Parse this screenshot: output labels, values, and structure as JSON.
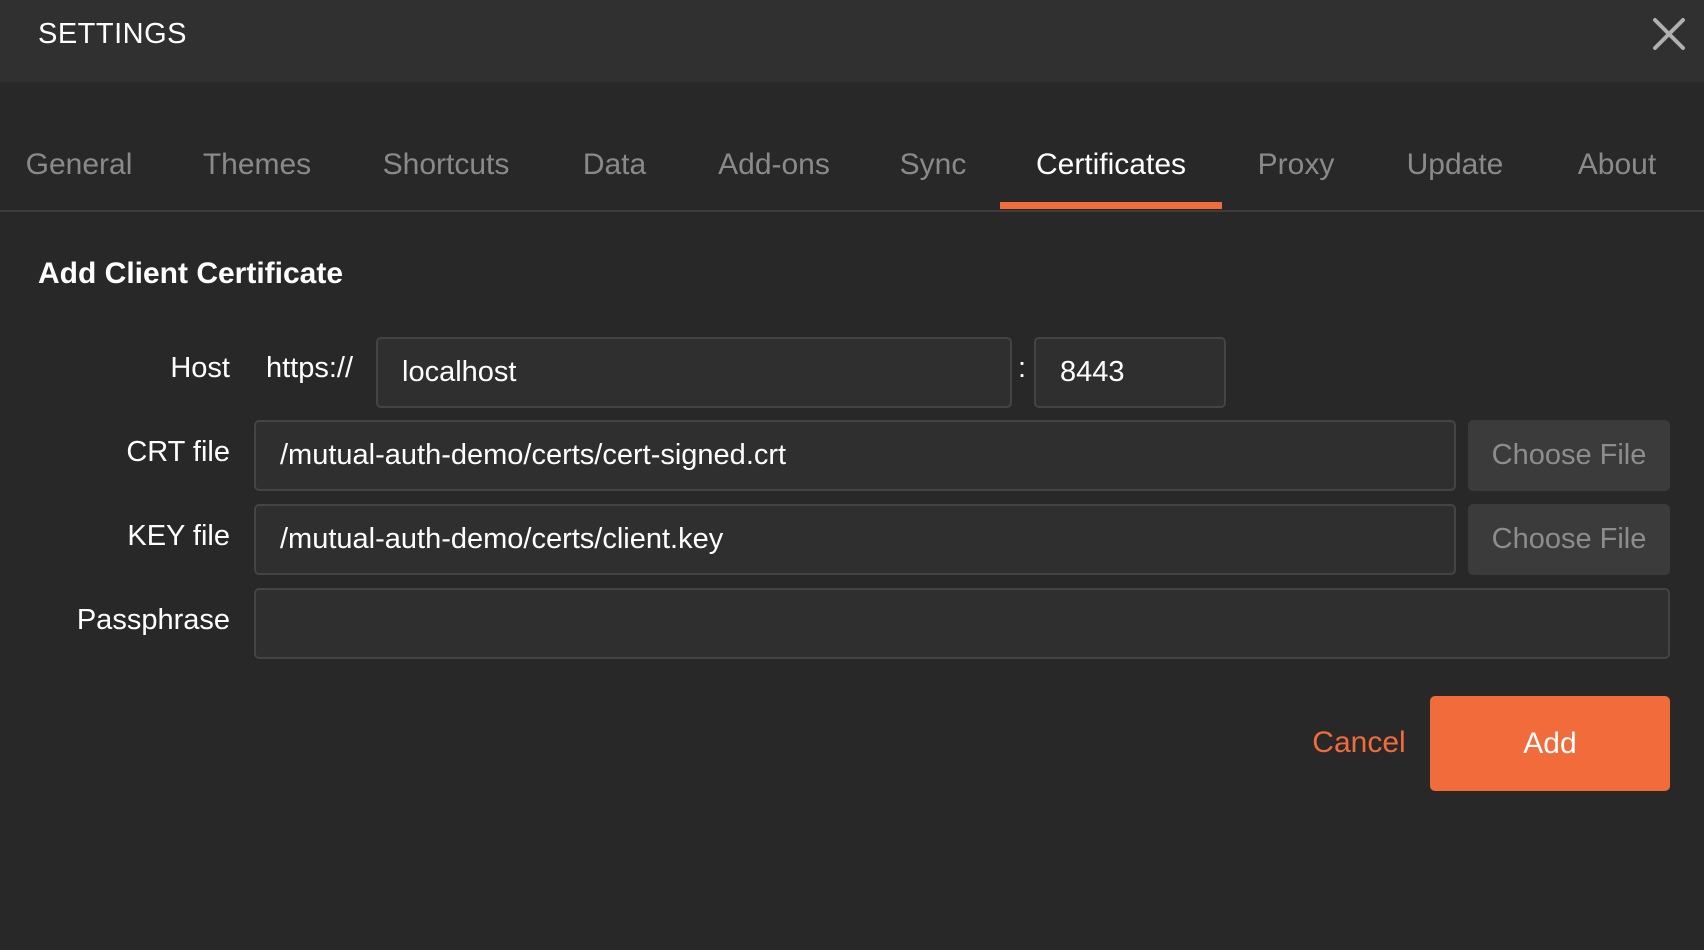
{
  "window": {
    "title": "SETTINGS",
    "close_icon": "close-icon"
  },
  "tabs": [
    {
      "label": "General",
      "active": false
    },
    {
      "label": "Themes",
      "active": false
    },
    {
      "label": "Shortcuts",
      "active": false
    },
    {
      "label": "Data",
      "active": false
    },
    {
      "label": "Add-ons",
      "active": false
    },
    {
      "label": "Sync",
      "active": false
    },
    {
      "label": "Certificates",
      "active": true
    },
    {
      "label": "Proxy",
      "active": false
    },
    {
      "label": "Update",
      "active": false
    },
    {
      "label": "About",
      "active": false
    }
  ],
  "form": {
    "title": "Add Client Certificate",
    "host": {
      "label": "Host",
      "prefix": "https://",
      "value": "localhost",
      "separator": ":",
      "port": "8443"
    },
    "crt_file": {
      "label": "CRT file",
      "value": "/mutual-auth-demo/certs/cert-signed.crt",
      "button_label": "Choose File"
    },
    "key_file": {
      "label": "KEY file",
      "value": "/mutual-auth-demo/certs/client.key",
      "button_label": "Choose File"
    },
    "passphrase": {
      "label": "Passphrase",
      "value": ""
    }
  },
  "actions": {
    "cancel_label": "Cancel",
    "add_label": "Add"
  },
  "colors": {
    "accent": "#f26b3a",
    "background": "#282828",
    "header": "#303030"
  }
}
